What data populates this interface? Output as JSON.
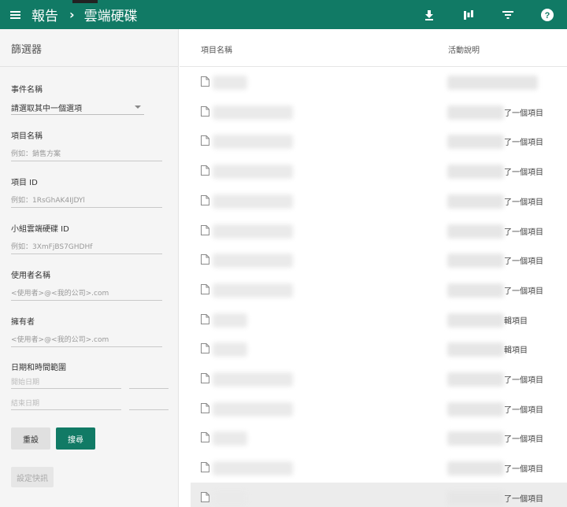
{
  "header": {
    "app_title": "報告",
    "separator": "›",
    "section": "雲端硬碟"
  },
  "sidebar": {
    "title": "篩選器",
    "event_name": {
      "label": "事件名稱",
      "selected": "請選取其中一個選項"
    },
    "item_name": {
      "label": "項目名稱",
      "placeholder": "例如：銷售方案"
    },
    "item_id": {
      "label": "項目 ID",
      "placeholder": "例如：1RsGhAK4IJDYl"
    },
    "shared_drive_id": {
      "label": "小組雲端硬碟 ID",
      "placeholder": "例如：3XmFjBS7GHDHf"
    },
    "user_name": {
      "label": "使用者名稱",
      "placeholder": "<使用者>@<我的公司>.com"
    },
    "owner": {
      "label": "擁有者",
      "placeholder": "<使用者>@<我的公司>.com"
    },
    "date_range": {
      "label": "日期和時間範圍",
      "start_placeholder": "開始日期",
      "end_placeholder": "結束日期"
    },
    "reset_label": "重設",
    "search_label": "搜尋",
    "alert_label": "設定快訊"
  },
  "table": {
    "columns": [
      "項目名稱",
      "活動說明"
    ],
    "rows": [
      {
        "activity": ""
      },
      {
        "activity": "了一個項目"
      },
      {
        "activity": "了一個項目"
      },
      {
        "activity": "了一個項目"
      },
      {
        "activity": "了一個項目"
      },
      {
        "activity": "了一個項目"
      },
      {
        "activity": "了一個項目"
      },
      {
        "activity": "了一個項目"
      },
      {
        "activity": "輯項目"
      },
      {
        "activity": "輯項目"
      },
      {
        "activity": "了一個項目"
      },
      {
        "activity": "了一個項目"
      },
      {
        "activity": "了一個項目"
      },
      {
        "activity": "了一個項目"
      },
      {
        "activity": "了一個項目"
      }
    ]
  },
  "icons": {
    "menu": "menu-icon",
    "download": "download-icon",
    "chart": "chart-icon",
    "filter": "filter-icon",
    "help": "help-icon",
    "file": "file-icon"
  },
  "colors": {
    "primary": "#117a65"
  }
}
